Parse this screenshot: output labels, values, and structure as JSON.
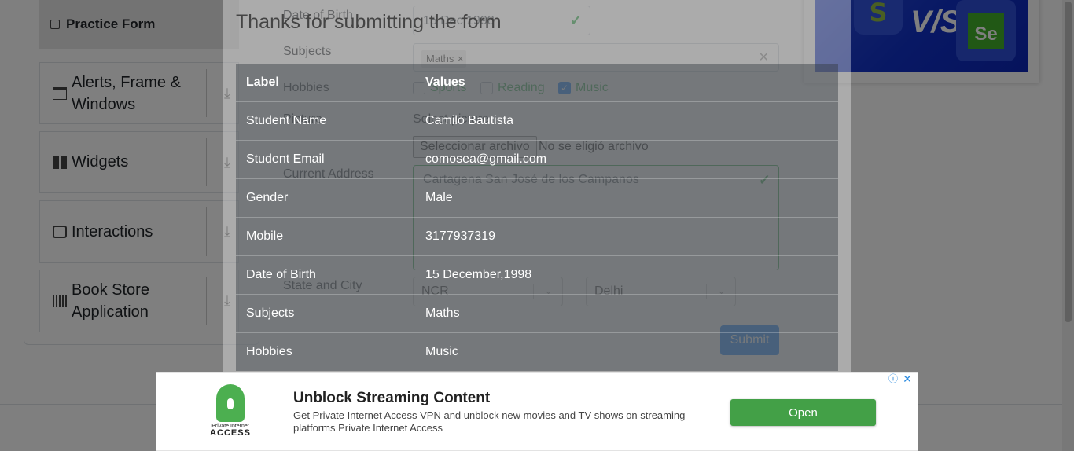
{
  "sidebar": {
    "practice_form": "Practice Form",
    "groups": [
      {
        "label": "Alerts, Frame & Windows",
        "icon": "window-icon"
      },
      {
        "label": "Widgets",
        "icon": "widgets-icon"
      },
      {
        "label": "Interactions",
        "icon": "interactions-icon"
      },
      {
        "label": "Book Store Application",
        "icon": "bookstore-icon"
      }
    ],
    "expand_icon": "⤓"
  },
  "form": {
    "dob_label": "Date of Birth",
    "dob_value": "15 Dec 1998",
    "subjects_label": "Subjects",
    "subject_chip": "Maths",
    "hobbies_label": "Hobbies",
    "hobbies": [
      {
        "label": "Sports",
        "checked": false
      },
      {
        "label": "Reading",
        "checked": false
      },
      {
        "label": "Music",
        "checked": true
      }
    ],
    "picture_label": "Picture",
    "picture_sub": "Select picture",
    "file_button": "Seleccionar archivo",
    "file_status": "No se eligió archivo",
    "address_label": "Current Address",
    "address_value": "Cartagena San José de los Campanos",
    "state_city_label": "State and City",
    "state_value": "NCR",
    "city_value": "Delhi",
    "submit_label": "Submit"
  },
  "banner": {
    "vs": "V/S",
    "shopify_letter": "S",
    "se_letters": "Se"
  },
  "modal": {
    "title": "Thanks for submitting the form",
    "table_header": {
      "label": "Label",
      "values": "Values"
    },
    "rows": [
      {
        "label": "Student Name",
        "value": "Camilo Bautista"
      },
      {
        "label": "Student Email",
        "value": "comosea@gmail.com"
      },
      {
        "label": "Gender",
        "value": "Male"
      },
      {
        "label": "Mobile",
        "value": "3177937319"
      },
      {
        "label": "Date of Birth",
        "value": "15 December,1998"
      },
      {
        "label": "Subjects",
        "value": "Maths"
      },
      {
        "label": "Hobbies",
        "value": "Music"
      }
    ]
  },
  "ad": {
    "brand_small": "Private Internet",
    "brand_big": "ACCESS",
    "title": "Unblock Streaming Content",
    "description": "Get Private Internet Access VPN and unblock new movies and TV shows on streaming platforms Private Internet Access",
    "open_label": "Open",
    "info_glyph": "ⓘ",
    "close_glyph": "✕"
  },
  "colors": {
    "accent": "#007bff",
    "success": "#28a745",
    "ad_button": "#43a047",
    "sidebar_group_dark": "#343a40"
  }
}
